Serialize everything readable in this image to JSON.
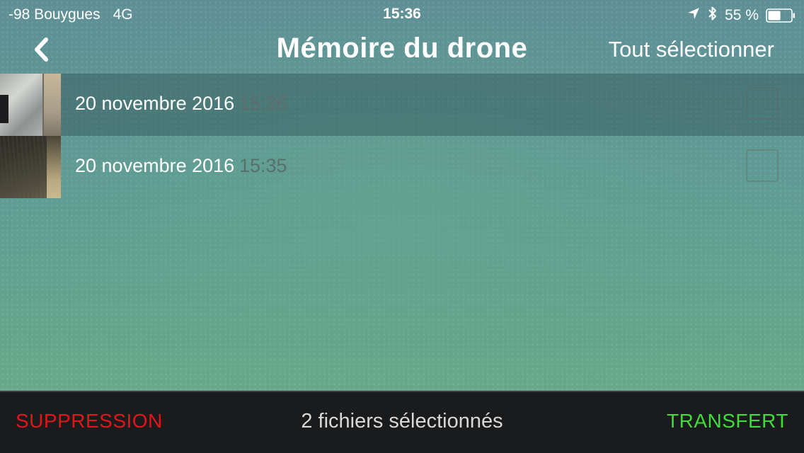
{
  "status_bar": {
    "carrier": "-98 Bouygues",
    "network": "4G",
    "time": "15:36",
    "battery_percent": "55 %",
    "battery_level": 0.55,
    "icons": [
      "location-arrow-icon",
      "bluetooth-icon",
      "battery-icon"
    ]
  },
  "nav": {
    "back_icon": "chevron-left-icon",
    "title": "Mémoire du drone",
    "select_all_label": "Tout sélectionner"
  },
  "files": [
    {
      "date": "20 novembre 2016",
      "time": "15:36",
      "highlighted": true,
      "checked": false
    },
    {
      "date": "20 novembre 2016",
      "time": "15:35",
      "highlighted": false,
      "checked": false
    }
  ],
  "bottom_bar": {
    "delete_label": "SUPPRESSION",
    "selection_text": "2 fichiers sélectionnés",
    "transfer_label": "TRANSFERT"
  },
  "colors": {
    "delete": "#e3151b",
    "transfer": "#3fdc3a",
    "bottom_bar_bg": "#1a1b1d"
  }
}
